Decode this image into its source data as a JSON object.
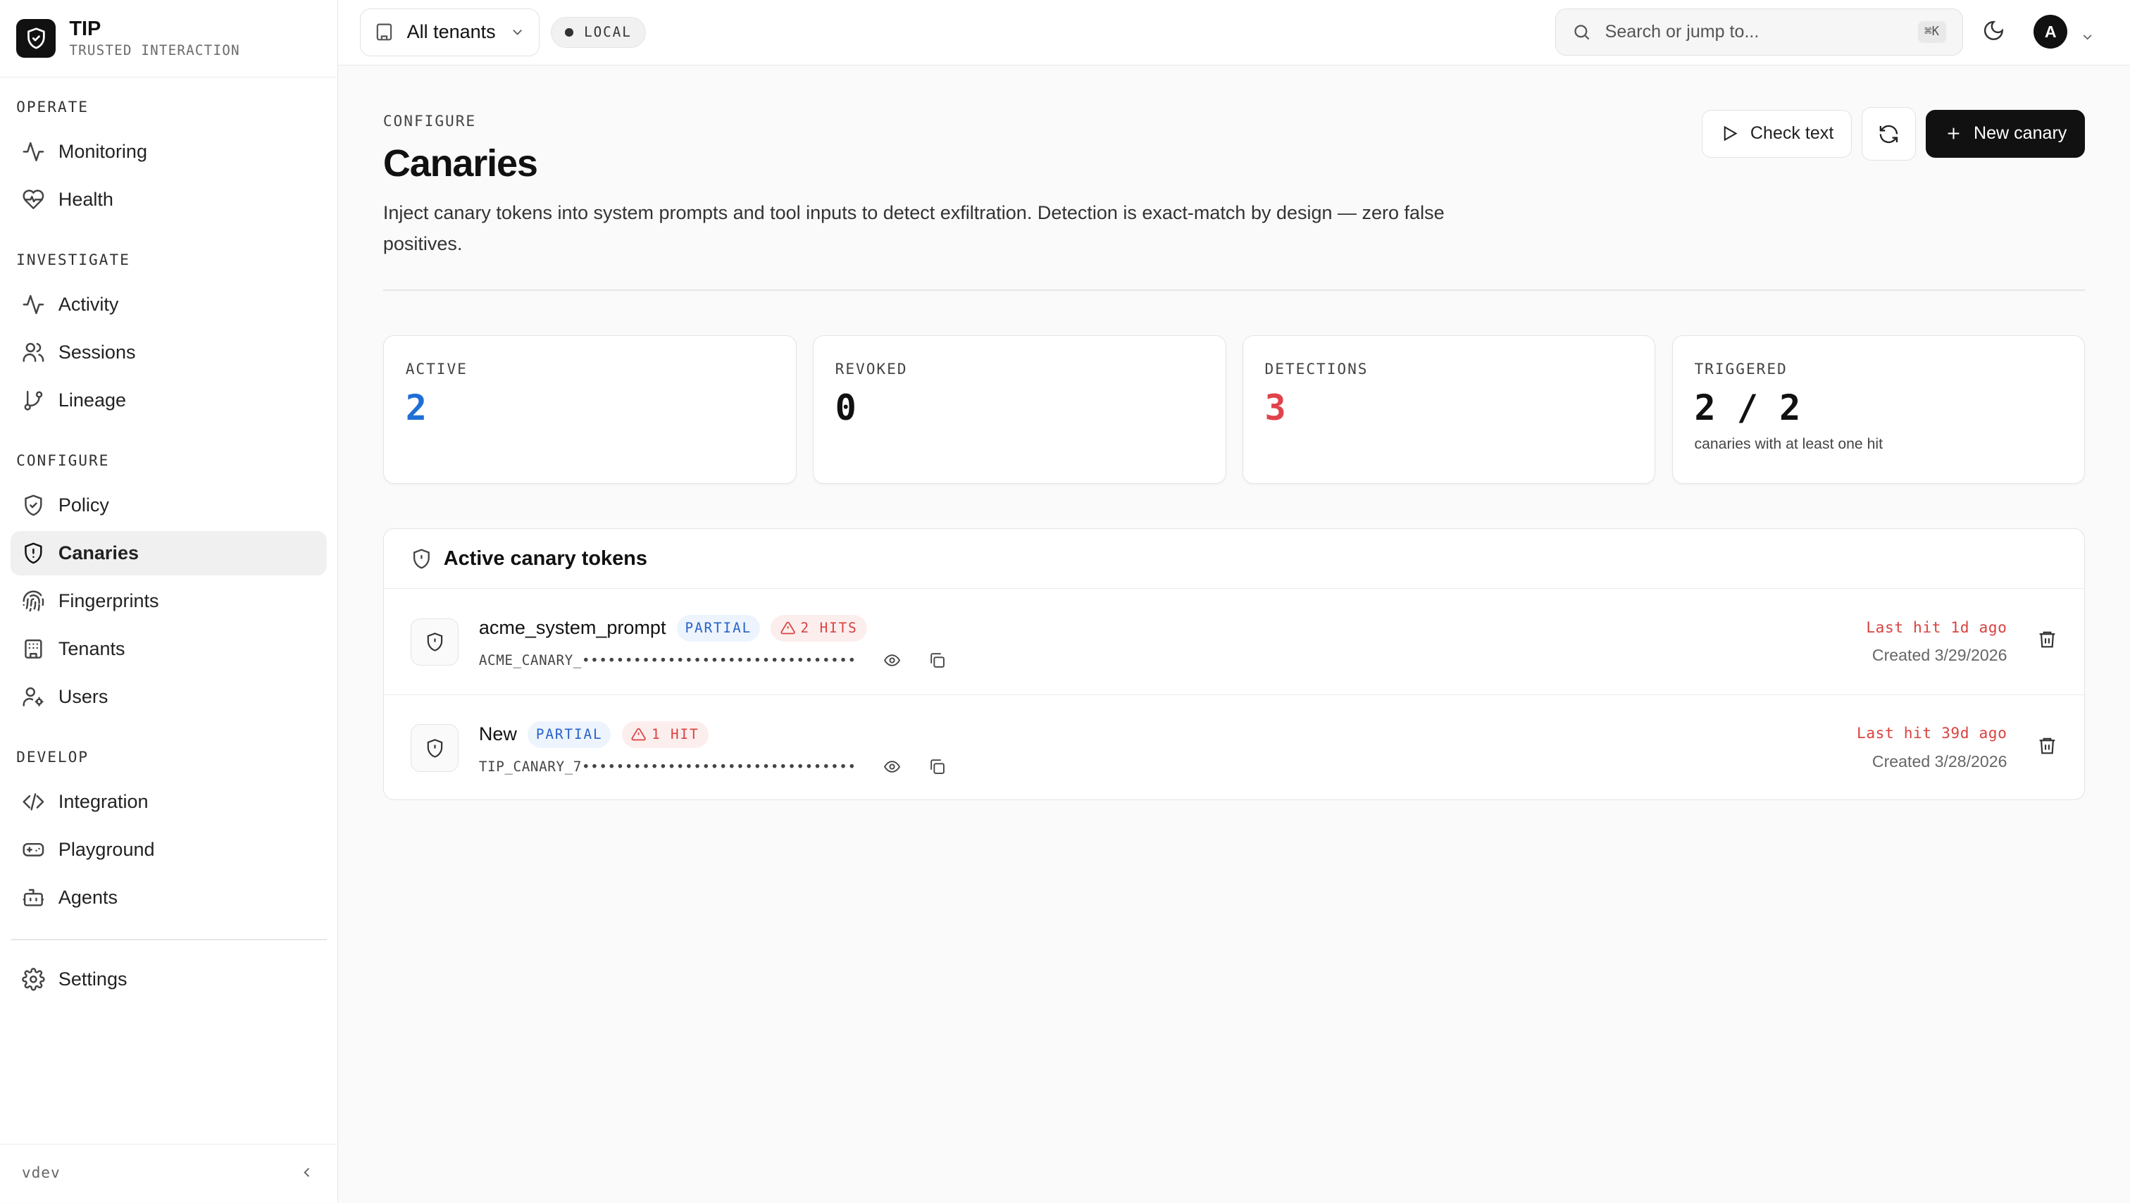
{
  "brand": {
    "name": "TIP",
    "subtitle": "TRUSTED INTERACTION"
  },
  "sidebar": {
    "sections": [
      {
        "heading": "OPERATE",
        "items": [
          {
            "label": "Monitoring",
            "icon": "activity-icon"
          },
          {
            "label": "Health",
            "icon": "heart-pulse-icon"
          }
        ]
      },
      {
        "heading": "INVESTIGATE",
        "items": [
          {
            "label": "Activity",
            "icon": "activity-icon"
          },
          {
            "label": "Sessions",
            "icon": "users-icon"
          },
          {
            "label": "Lineage",
            "icon": "git-branch-icon"
          }
        ]
      },
      {
        "heading": "CONFIGURE",
        "items": [
          {
            "label": "Policy",
            "icon": "shield-check-icon"
          },
          {
            "label": "Canaries",
            "icon": "shield-alert-icon",
            "active": true
          },
          {
            "label": "Fingerprints",
            "icon": "fingerprint-icon"
          },
          {
            "label": "Tenants",
            "icon": "building-icon"
          },
          {
            "label": "Users",
            "icon": "user-cog-icon"
          }
        ]
      },
      {
        "heading": "DEVELOP",
        "items": [
          {
            "label": "Integration",
            "icon": "code-icon"
          },
          {
            "label": "Playground",
            "icon": "gamepad-icon"
          },
          {
            "label": "Agents",
            "icon": "bot-icon"
          }
        ]
      }
    ],
    "settings_label": "Settings",
    "version": "vdev"
  },
  "topbar": {
    "tenant_label": "All tenants",
    "env_label": "LOCAL",
    "search_placeholder": "Search or jump to...",
    "search_shortcut": "⌘K",
    "avatar_initial": "A"
  },
  "page": {
    "eyebrow": "CONFIGURE",
    "title": "Canaries",
    "description": "Inject canary tokens into system prompts and tool inputs to detect exfiltration. Detection is exact-match by design — zero false positives.",
    "check_text_label": "Check text",
    "new_canary_label": "New canary"
  },
  "stats": {
    "active": {
      "label": "ACTIVE",
      "value": "2",
      "color": "#1f6fd6"
    },
    "revoked": {
      "label": "REVOKED",
      "value": "0",
      "color": "#111111"
    },
    "detections": {
      "label": "DETECTIONS",
      "value": "3",
      "color": "#e0434b"
    },
    "triggered": {
      "label": "TRIGGERED",
      "value": "2 / 2",
      "sub": "canaries with at least one hit"
    }
  },
  "tokens": {
    "title": "Active canary tokens",
    "rows": [
      {
        "name": "acme_system_prompt",
        "match": "PARTIAL",
        "hits": "2 HITS",
        "token": "ACME_CANARY_••••••••••••••••••••••••••••••••",
        "last_hit": "Last hit 1d ago",
        "created": "Created 3/29/2026"
      },
      {
        "name": "New",
        "match": "PARTIAL",
        "hits": "1 HIT",
        "token": "TIP_CANARY_7••••••••••••••••••••••••••••••••",
        "last_hit": "Last hit 39d ago",
        "created": "Created 3/28/2026"
      }
    ]
  }
}
